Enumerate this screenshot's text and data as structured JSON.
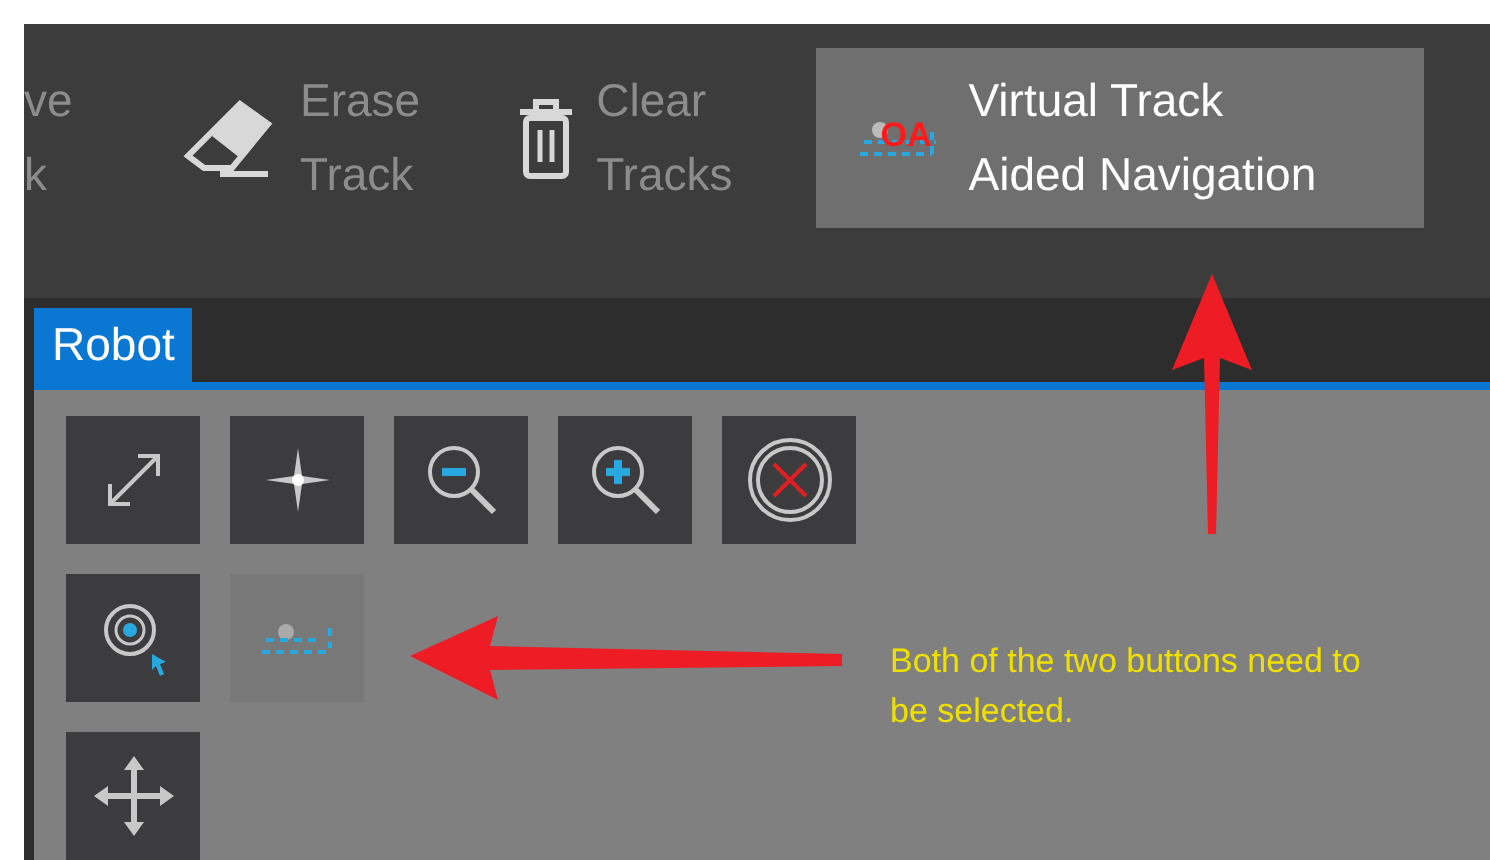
{
  "ribbon": [
    {
      "kind": "cut",
      "lines": [
        "ve",
        "k"
      ],
      "selected": false
    },
    {
      "kind": "eraser",
      "lines": [
        "Erase",
        "Track"
      ],
      "selected": false
    },
    {
      "kind": "trash",
      "lines": [
        "Clear",
        "Tracks"
      ],
      "selected": false
    },
    {
      "kind": "oa",
      "icon_text": "OA",
      "lines": [
        "Virtual Track",
        "Aided Navigation"
      ],
      "selected": true
    }
  ],
  "panel": {
    "tab": {
      "label": "Robot",
      "selected": true
    },
    "tools": [
      [
        {
          "kind": "expand",
          "selected": false
        },
        {
          "kind": "center",
          "selected": false
        },
        {
          "kind": "zoom-out",
          "selected": false
        },
        {
          "kind": "zoom-in",
          "selected": false
        },
        {
          "kind": "cancel",
          "selected": false
        }
      ],
      [
        {
          "kind": "locate",
          "selected": false
        },
        {
          "kind": "track",
          "selected": true
        }
      ],
      [
        {
          "kind": "move",
          "selected": false
        }
      ]
    ]
  },
  "annotation": {
    "text": "Both of the two buttons need to be selected."
  }
}
